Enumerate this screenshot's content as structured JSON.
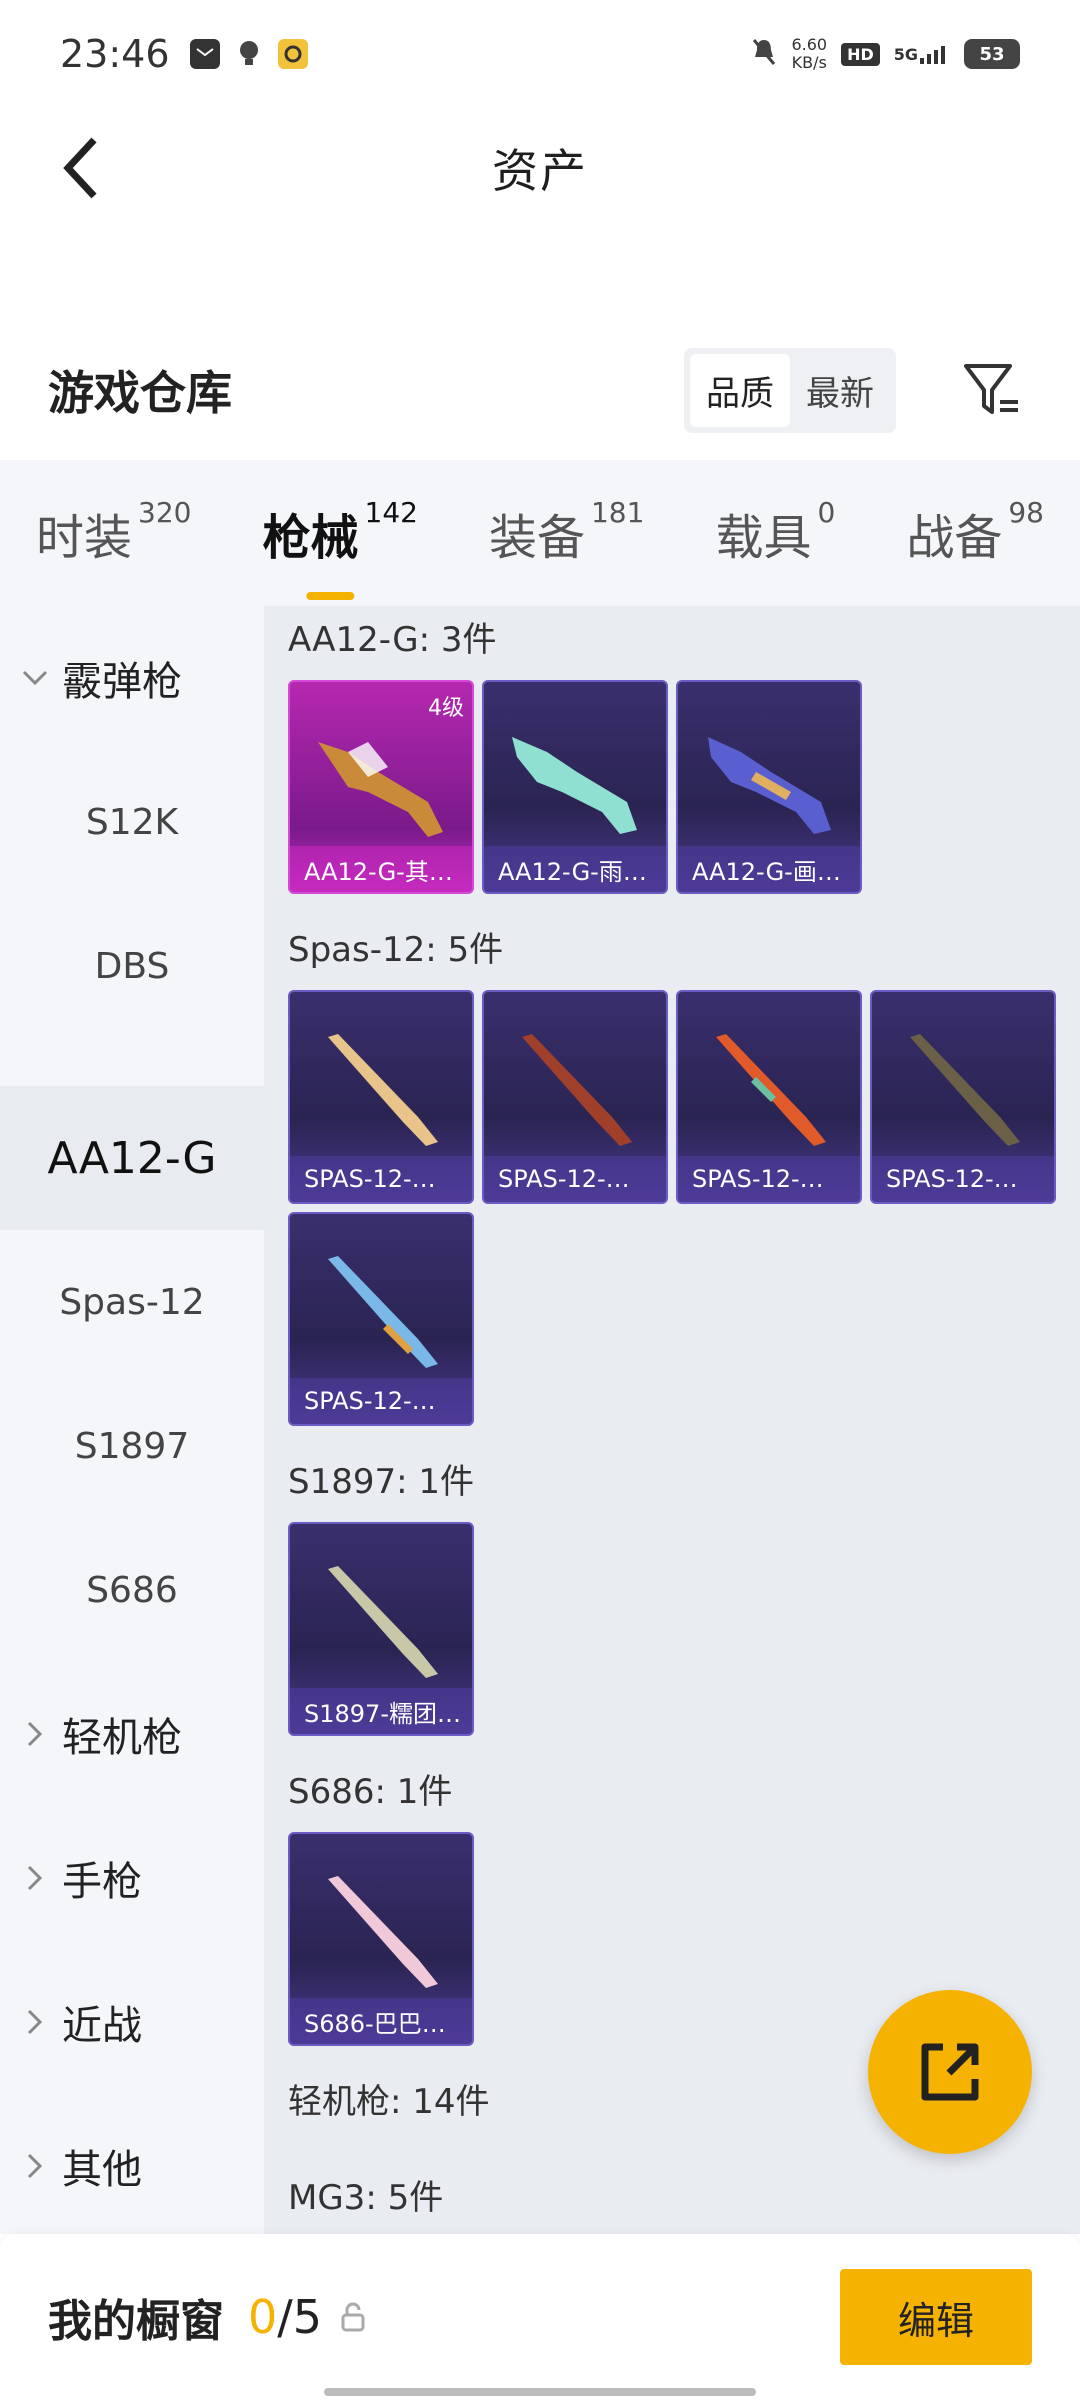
{
  "status_bar": {
    "time": "23:46",
    "net_speed_value": "6.60",
    "net_speed_unit": "KB/s",
    "hd_label": "HD",
    "signal_label": "5G",
    "battery": "53"
  },
  "header": {
    "title": "资产"
  },
  "warehouse": {
    "title": "游戏仓库",
    "sort_options": [
      "品质",
      "最新"
    ],
    "sort_selected": "品质"
  },
  "tabs": [
    {
      "label": "时装",
      "count": "320"
    },
    {
      "label": "枪械",
      "count": "142",
      "active": true
    },
    {
      "label": "装备",
      "count": "181"
    },
    {
      "label": "载具",
      "count": "0"
    },
    {
      "label": "战备",
      "count": "98"
    }
  ],
  "sidebar": {
    "groups": [
      {
        "label": "霰弹枪",
        "expanded": true
      },
      {
        "label": "S12K"
      },
      {
        "label": "DBS"
      },
      {
        "label": "AA12-G",
        "active": true
      },
      {
        "label": "Spas-12"
      },
      {
        "label": "S1897"
      },
      {
        "label": "S686"
      },
      {
        "label": "轻机枪",
        "expanded": false
      },
      {
        "label": "手枪",
        "expanded": false
      },
      {
        "label": "近战",
        "expanded": false
      },
      {
        "label": "其他",
        "expanded": false
      }
    ]
  },
  "content": {
    "sections": [
      {
        "header": "AA12-G: 3件",
        "items": [
          {
            "name": "AA12-G-其…",
            "grade": "4级",
            "rarity": "pink"
          },
          {
            "name": "AA12-G-雨…",
            "rarity": "purple"
          },
          {
            "name": "AA12-G-画…",
            "rarity": "purple"
          }
        ]
      },
      {
        "header": "Spas-12: 5件",
        "items": [
          {
            "name": "SPAS-12-…",
            "rarity": "purple"
          },
          {
            "name": "SPAS-12-…",
            "rarity": "purple"
          },
          {
            "name": "SPAS-12-…",
            "rarity": "purple"
          },
          {
            "name": "SPAS-12-…",
            "rarity": "purple"
          },
          {
            "name": "SPAS-12-…",
            "rarity": "purple"
          }
        ]
      },
      {
        "header": "S1897: 1件",
        "items": [
          {
            "name": "S1897-糯团…",
            "rarity": "purple"
          }
        ]
      },
      {
        "header": "S686: 1件",
        "items": [
          {
            "name": "S686-巴巴…",
            "rarity": "purple"
          }
        ]
      },
      {
        "header": "轻机枪: 14件",
        "items": []
      },
      {
        "header": "MG3: 5件",
        "items": []
      }
    ]
  },
  "showcase": {
    "title": "我的橱窗",
    "count_current": "0",
    "count_total": "/5",
    "edit_label": "编辑"
  },
  "colors": {
    "accent": "#f6b200",
    "card_purple": "#3a2f6e",
    "card_pink": "#b528b0"
  },
  "icons": {
    "back": "chevron-left-icon",
    "filter": "filter-icon",
    "share": "share-external-icon",
    "lock": "lock-icon"
  }
}
